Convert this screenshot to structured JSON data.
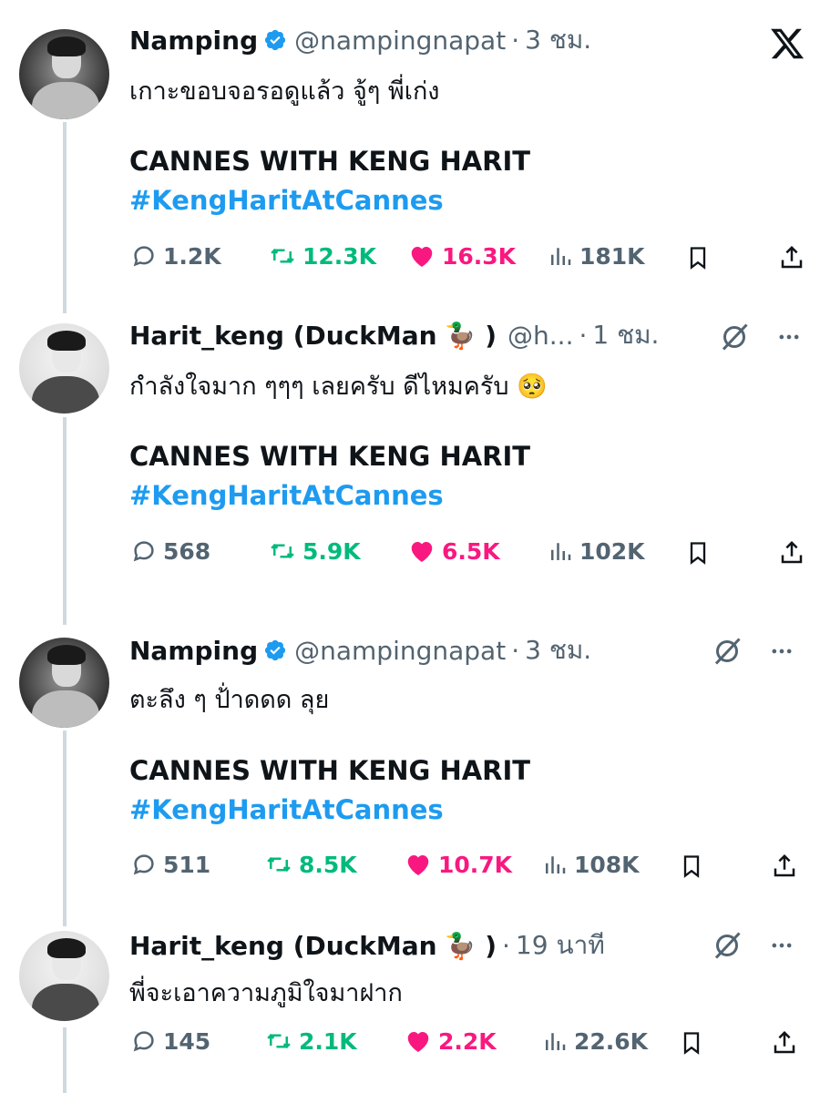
{
  "tweets": [
    {
      "name": "Namping",
      "verified": true,
      "handle": "@nampingnapat",
      "time": "3 ชม.",
      "text": "เกาะขอบจอรอดูแล้ว จู้ๆ พี่เก่ง",
      "headline": "CANNES WITH KENG HARIT",
      "hashtag": "#KengHaritAtCannes",
      "replies": "1.2K",
      "retweets": "12.3K",
      "likes": "16.3K",
      "views": "181K"
    },
    {
      "name": "Harit_keng (DuckMan",
      "duck": "🦆 )",
      "handle": "@h...",
      "time": "1 ชม.",
      "text": "กำลังใจมาก ๆๆๆ เลยครับ ดีไหมครับ 🥺",
      "headline": "CANNES WITH KENG HARIT",
      "hashtag": "#KengHaritAtCannes",
      "replies": "568",
      "retweets": "5.9K",
      "likes": "6.5K",
      "views": "102K"
    },
    {
      "name": "Namping",
      "verified": true,
      "handle": "@nampingnapat",
      "time": "3 ชม.",
      "text": "ตะลึง ๆ ป้่าดดด ลุย",
      "headline": "CANNES WITH KENG HARIT",
      "hashtag": "#KengHaritAtCannes",
      "replies": "511",
      "retweets": "8.5K",
      "likes": "10.7K",
      "views": "108K"
    },
    {
      "name": "Harit_keng (DuckMan",
      "duck": "🦆 )",
      "time": "19 นาที",
      "text": "พี่จะเอาความภูมิใจมาฝาก",
      "replies": "145",
      "retweets": "2.1K",
      "likes": "2.2K",
      "views": "22.6K"
    }
  ],
  "colors": {
    "text": "#0f1419",
    "secondary": "#536471",
    "link": "#1d9bf0",
    "retweet": "#00ba7c",
    "like": "#f91880",
    "verified": "#1d9bf0"
  },
  "icons": [
    "x-logo",
    "verified-badge",
    "reply-icon",
    "retweet-icon",
    "like-icon",
    "views-icon",
    "bookmark-icon",
    "share-icon",
    "grok-icon",
    "more-icon"
  ]
}
